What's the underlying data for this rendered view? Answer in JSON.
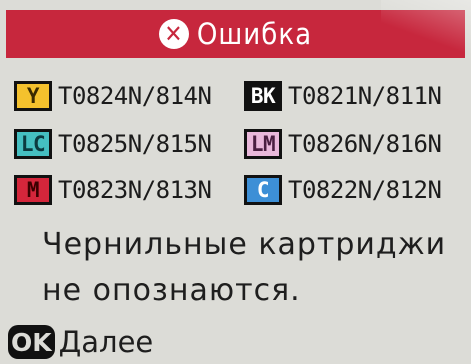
{
  "header": {
    "title": "Ошибка",
    "icon": "close-circle-icon",
    "color": "#c7273d"
  },
  "cartridges": [
    {
      "badge": "Y",
      "code": "T0824N/814N",
      "badge_bg": "#f4c12d",
      "badge_fg": "#3a2a00"
    },
    {
      "badge": "BK",
      "code": "T0821N/811N",
      "badge_bg": "#111111",
      "badge_fg": "#ffffff"
    },
    {
      "badge": "LC",
      "code": "T0825N/815N",
      "badge_bg": "#45bfc1",
      "badge_fg": "#0c3a40"
    },
    {
      "badge": "LM",
      "code": "T0826N/816N",
      "badge_bg": "#e9b8da",
      "badge_fg": "#4a1f40"
    },
    {
      "badge": "M",
      "code": "T0823N/813N",
      "badge_bg": "#d4263b",
      "badge_fg": "#3a0000"
    },
    {
      "badge": "C",
      "code": "T0822N/812N",
      "badge_bg": "#3d8fd6",
      "badge_fg": "#ffffff"
    }
  ],
  "message": {
    "line1": "Чернильные картриджи",
    "line2": "не опознаются."
  },
  "footer": {
    "ok_label": "OK",
    "next_label": "Далее"
  }
}
